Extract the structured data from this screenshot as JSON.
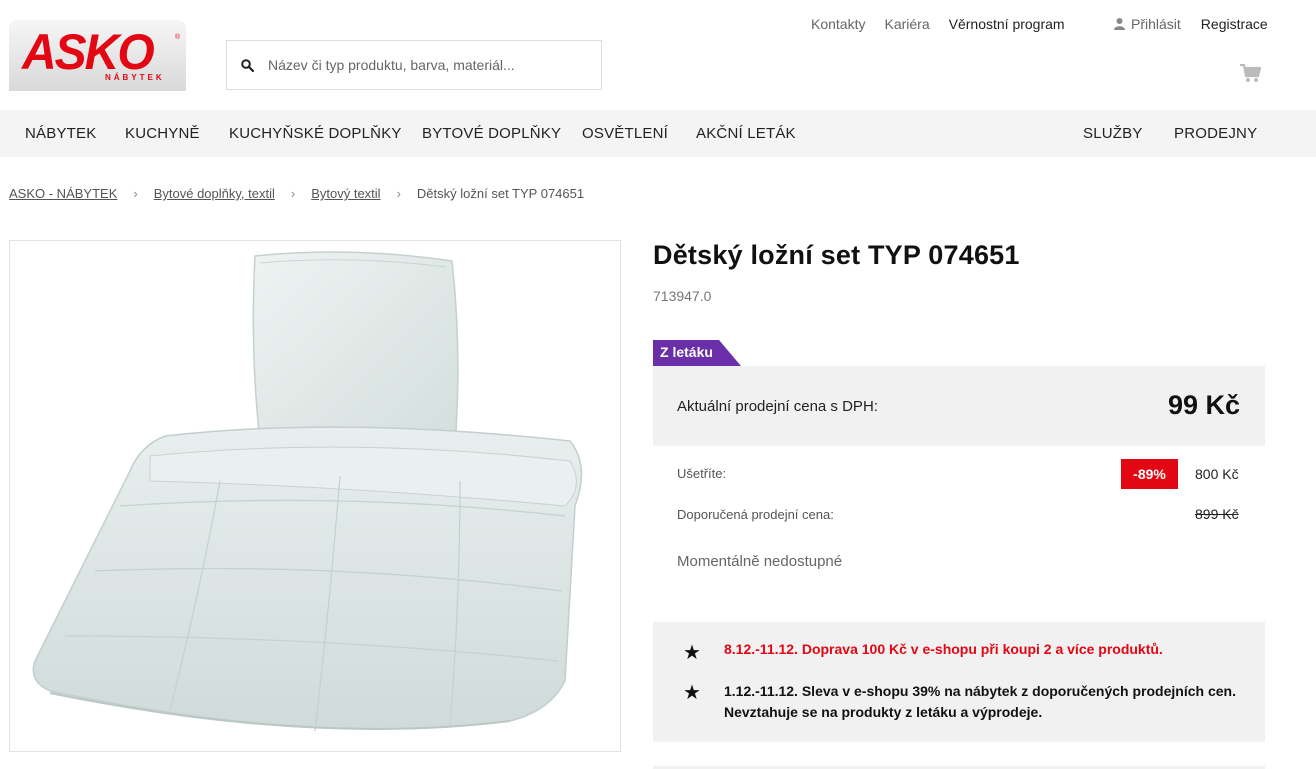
{
  "logo": {
    "word": "ASKO",
    "sub": "NÁBYTEK",
    "reg": "®"
  },
  "search": {
    "placeholder": "Název či typ produktu, barva, materiál..."
  },
  "toplinks": [
    "Kontakty",
    "Kariéra",
    "Věrnostní program"
  ],
  "user": {
    "login": "Přihlásit",
    "register": "Registrace"
  },
  "nav": {
    "left": [
      "NÁBYTEK",
      "KUCHYNĚ",
      "KUCHYŇSKÉ DOPLŇKY",
      "BYTOVÉ DOPLŇKY",
      "OSVĚTLENÍ",
      "AKČNÍ LETÁK"
    ],
    "right": [
      "SLUŽBY",
      "PRODEJNY"
    ]
  },
  "breadcrumb": [
    "ASKO - NÁBYTEK",
    "Bytové doplňky, textil",
    "Bytový textil",
    "Dětský ložní set TYP 074651"
  ],
  "product": {
    "title": "Dětský ložní set TYP 074651",
    "code": "713947.0",
    "badge": "Z letáku",
    "price_label": "Aktuální prodejní cena s DPH:",
    "price": "99 Kč",
    "save_label": "Ušetříte:",
    "discount": "-89%",
    "save_value": "800 Kč",
    "rec_label": "Doporučená prodejní cena:",
    "rec_value": "899 Kč",
    "availability": "Momentálně nedostupné"
  },
  "promo": {
    "line1": "8.12.-11.12. Doprava 100 Kč v e-shopu při koupi 2 a více produktů.",
    "line2": "1.12.-11.12. Sleva v e-shopu 39% na nábytek z doporučených prodejních cen. Nevztahuje se na produkty z letáku a výprodeje."
  },
  "colors": {
    "brand": "#e30613",
    "badge": "#6a2ea8",
    "panel": "#f1f1f1"
  },
  "icons": [
    "search-icon",
    "user-icon",
    "cart-icon",
    "star-icon"
  ]
}
